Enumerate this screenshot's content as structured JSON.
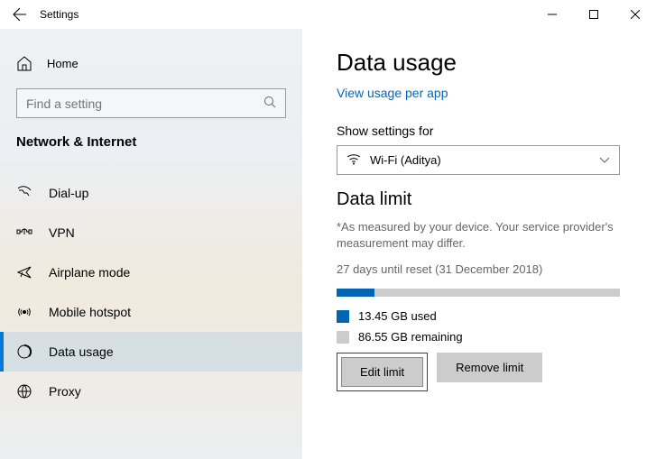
{
  "window": {
    "title": "Settings"
  },
  "sidebar": {
    "home": "Home",
    "search_placeholder": "Find a setting",
    "section": "Network & Internet",
    "items": [
      {
        "label": "Dial-up"
      },
      {
        "label": "VPN"
      },
      {
        "label": "Airplane mode"
      },
      {
        "label": "Mobile hotspot"
      },
      {
        "label": "Data usage"
      },
      {
        "label": "Proxy"
      }
    ]
  },
  "main": {
    "heading": "Data usage",
    "link": "View usage per app",
    "show_label": "Show settings for",
    "connection": "Wi-Fi (Aditya)",
    "limit_heading": "Data limit",
    "note": "*As measured by your device. Your service provider's measurement may differ.",
    "reset": "27 days until reset (31 December 2018)",
    "used": "13.45 GB used",
    "remaining": "86.55 GB remaining",
    "edit": "Edit limit",
    "remove": "Remove limit",
    "colors": {
      "used": "#0065b3",
      "remaining": "#cccccc"
    }
  }
}
